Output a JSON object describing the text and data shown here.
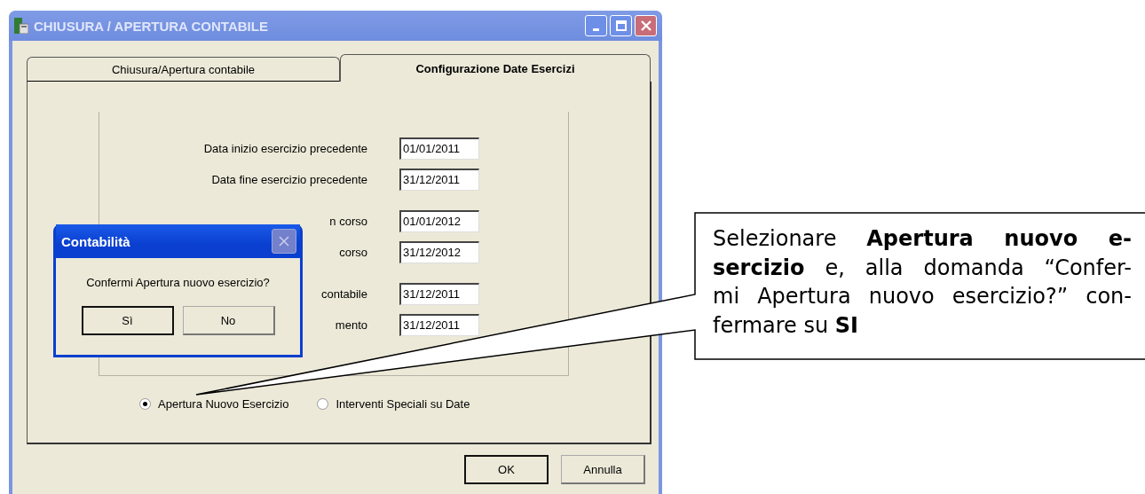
{
  "window": {
    "title": "CHIUSURA / APERTURA CONTABILE"
  },
  "tabs": [
    {
      "label": "Chiusura/Apertura contabile",
      "selected": false
    },
    {
      "label": "Configurazione Date Esercizi",
      "selected": true
    }
  ],
  "date_groups": [
    {
      "fields": [
        {
          "label": "Data inizio esercizio precedente",
          "value": "01/01/2011"
        },
        {
          "label": "Data fine esercizio precedente",
          "value": "31/12/2011"
        }
      ]
    },
    {
      "fields": [
        {
          "label": "n corso",
          "value": "01/01/2012"
        },
        {
          "label": "corso",
          "value": "31/12/2012"
        }
      ]
    },
    {
      "fields": [
        {
          "label": "contabile",
          "value": "31/12/2011"
        },
        {
          "label": "mento",
          "value": "31/12/2011"
        }
      ]
    }
  ],
  "options": [
    {
      "label": "Apertura Nuovo Esercizio",
      "selected": true
    },
    {
      "label": "Interventi Speciali su Date",
      "selected": false
    }
  ],
  "buttons": [
    {
      "label": "OK",
      "default": true
    },
    {
      "label": "Annulla",
      "default": false
    }
  ],
  "dialog": {
    "title": "Contabilità",
    "message": "Confermi Apertura nuovo esercizio?",
    "buttons": [
      {
        "label": "Sì",
        "default": true
      },
      {
        "label": "No",
        "default": false
      }
    ]
  },
  "callout": {
    "lines": [
      "Selezionare **Apertura nuovo e-**",
      "**sercizio** e, alla domanda “Confer-",
      "mi Apertura nuovo esercizio?” con-",
      "fermare su **SI**"
    ]
  }
}
